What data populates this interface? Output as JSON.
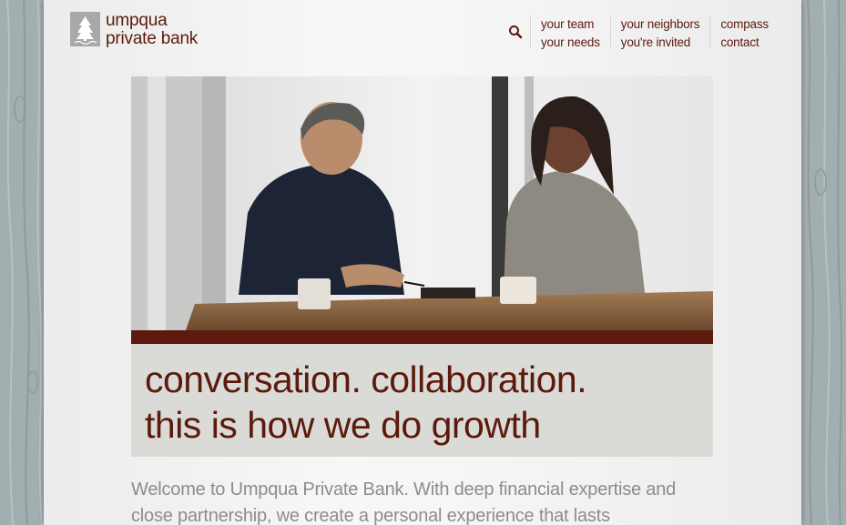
{
  "brand": {
    "name_line1": "umpqua",
    "name_line2": "private bank",
    "color": "#5b1a0c"
  },
  "header": {
    "search_icon": "search-icon",
    "nav": {
      "col1": [
        "your team",
        "your needs"
      ],
      "col2": [
        "your neighbors",
        "you're invited"
      ],
      "col3": [
        "compass",
        "contact"
      ]
    }
  },
  "hero": {
    "image": "photo of two people talking at a table with coffee mugs"
  },
  "tagline": {
    "line1": "conversation. collaboration.",
    "line2": "this is how we do growth"
  },
  "intro": {
    "text": "Welcome to Umpqua Private Bank. With deep financial expertise and close partnership, we create a personal experience that lasts"
  }
}
